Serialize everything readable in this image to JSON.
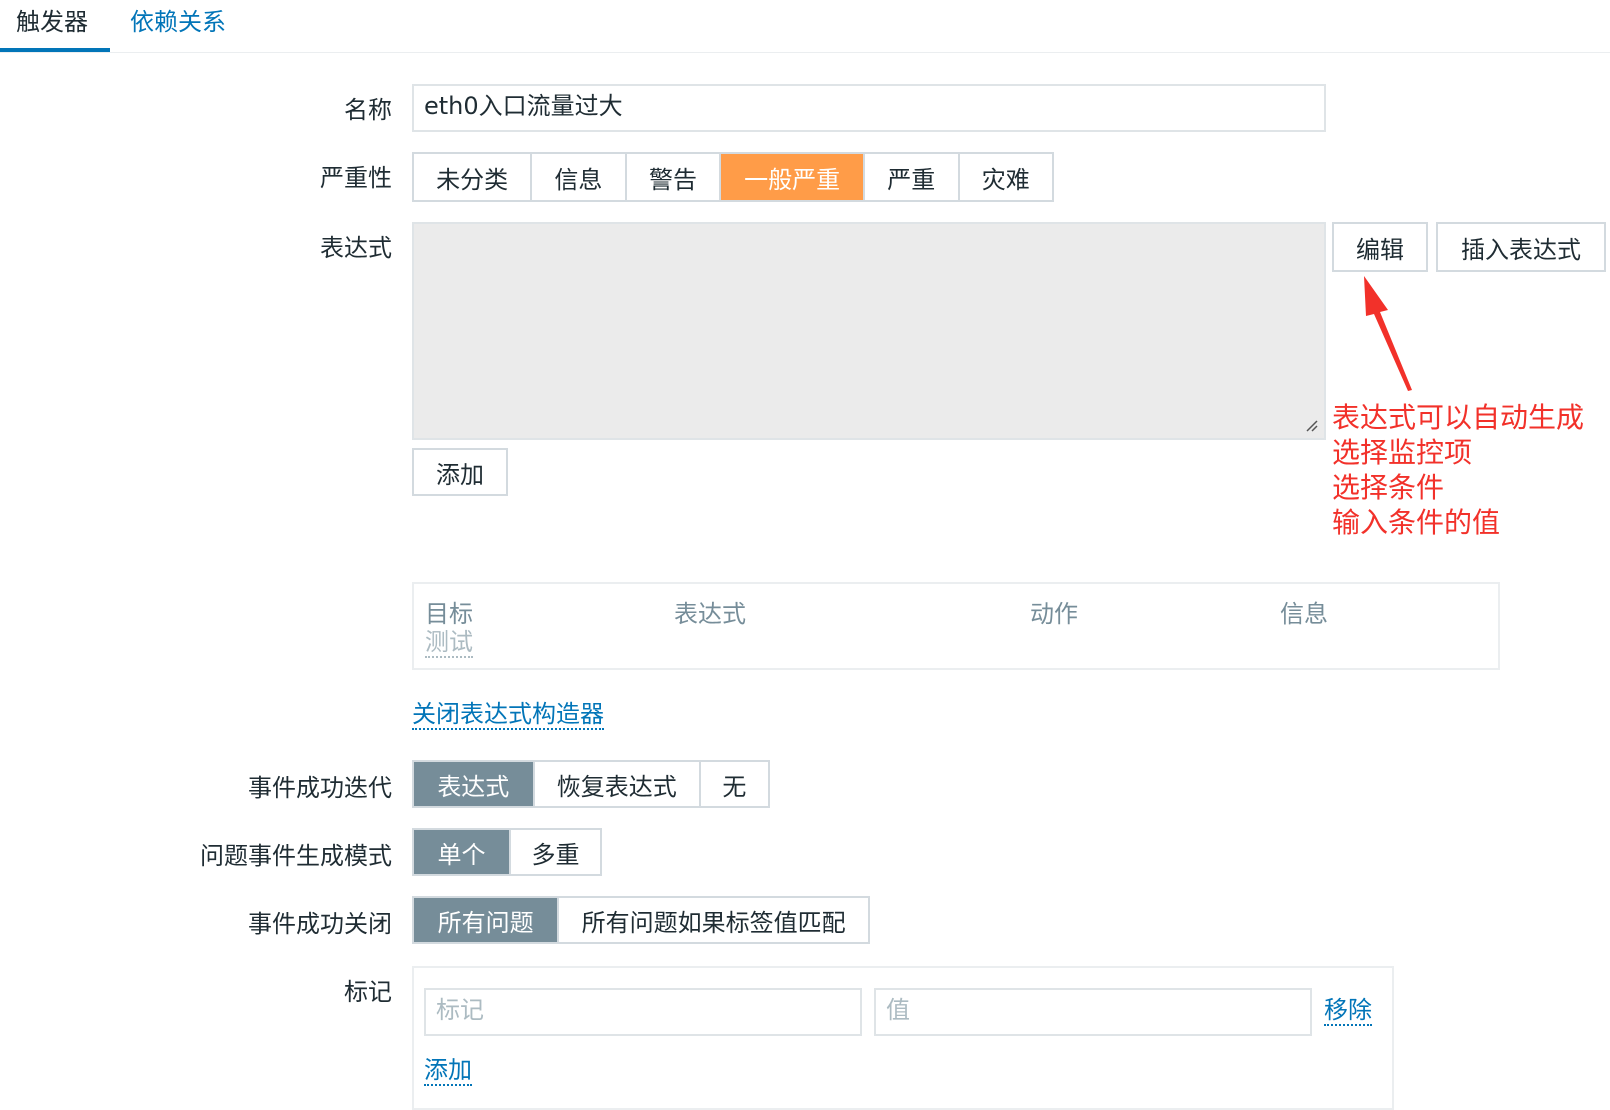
{
  "tabs": {
    "triggers": "触发器",
    "dependencies": "依赖关系"
  },
  "form": {
    "name_label": "名称",
    "name_value": "eth0入口流量过大",
    "severity_label": "严重性",
    "severity_options": [
      "未分类",
      "信息",
      "警告",
      "一般严重",
      "严重",
      "灾难"
    ],
    "severity_selected": "一般严重",
    "expression_label": "表达式",
    "edit_button": "编辑",
    "insert_expression_button": "插入表达式",
    "add_button": "添加",
    "builder_table": {
      "headers": [
        "目标",
        "表达式",
        "动作",
        "信息"
      ],
      "test_link": "测试"
    },
    "close_builder_link": "关闭表达式构造器",
    "ok_event_generation_label": "事件成功迭代",
    "ok_event_generation_options": [
      "表达式",
      "恢复表达式",
      "无"
    ],
    "problem_mode_label": "问题事件生成模式",
    "problem_mode_options": [
      "单个",
      "多重"
    ],
    "ok_event_closes_label": "事件成功关闭",
    "ok_event_closes_options": [
      "所有问题",
      "所有问题如果标签值匹配"
    ],
    "tags_label": "标记",
    "tag_placeholder": "标记",
    "value_placeholder": "值",
    "remove_link": "移除",
    "add_tag_link": "添加"
  },
  "annotation": {
    "lines": [
      "表达式可以自动生成",
      "选择监控项",
      "选择条件",
      "输入条件的值"
    ],
    "color": "#f2312a"
  },
  "colors": {
    "accent": "#0275b8",
    "severity_selected": "#ff9c48",
    "segment_selected": "#768d99"
  }
}
